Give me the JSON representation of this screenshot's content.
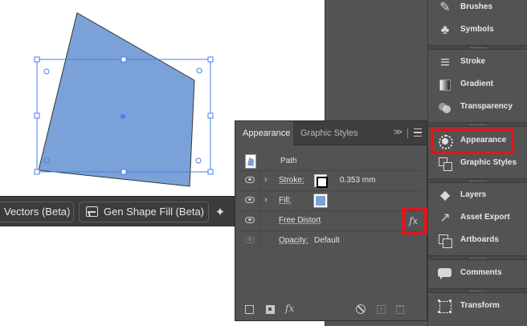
{
  "colors": {
    "shape_fill": "#7aa2d8",
    "selection": "#4a7df0",
    "highlight": "#e3141b",
    "panel_bg": "#535353"
  },
  "taskbar": {
    "vectors_label": "Vectors (Beta)",
    "shape_fill_label": "Gen Shape Fill (Beta)",
    "shape_fill_icon": "gen-shape-fill-icon",
    "more_icon": "wand-more-icon"
  },
  "appearance_panel": {
    "tabs": [
      "Appearance",
      "Graphic Styles"
    ],
    "active_tab": "Appearance",
    "collapse_label": ">>",
    "object_label": "Path",
    "rows": {
      "stroke": {
        "label": "Stroke:",
        "swatch": "#000000",
        "value": "0.353 mm"
      },
      "fill": {
        "label": "Fill:",
        "swatch": "#7aa2d8"
      },
      "effect": {
        "label": "Free Distort",
        "badge": "fx"
      },
      "opacity": {
        "label": "Opacity:",
        "value": "Default"
      }
    },
    "footer": {
      "fx_label": "fx"
    }
  },
  "dock": {
    "items": [
      {
        "label": "Brushes",
        "icon": "brush-icon"
      },
      {
        "label": "Symbols",
        "icon": "clubs-icon"
      },
      {
        "label": "Stroke",
        "icon": "stroke-lines-icon"
      },
      {
        "label": "Gradient",
        "icon": "gradient-icon"
      },
      {
        "label": "Transparency",
        "icon": "transparency-icon"
      },
      {
        "label": "Appearance",
        "icon": "appearance-icon"
      },
      {
        "label": "Graphic Styles",
        "icon": "graphic-styles-icon"
      },
      {
        "label": "Layers",
        "icon": "layers-icon"
      },
      {
        "label": "Asset Export",
        "icon": "asset-export-icon"
      },
      {
        "label": "Artboards",
        "icon": "artboards-icon"
      },
      {
        "label": "Comments",
        "icon": "comments-icon"
      },
      {
        "label": "Transform",
        "icon": "transform-icon"
      }
    ]
  }
}
